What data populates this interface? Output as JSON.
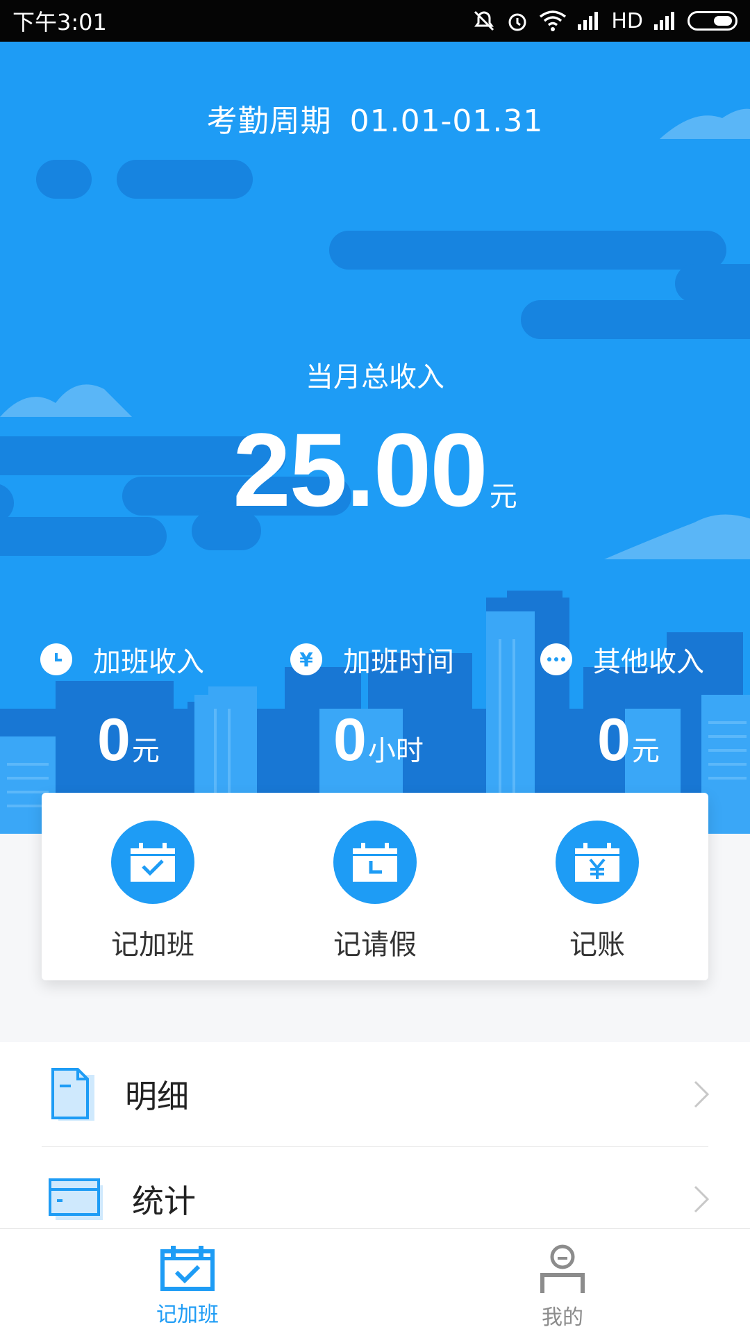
{
  "status_bar": {
    "time": "下午3:01",
    "network_label": "HD"
  },
  "header": {
    "cycle_label": "考勤周期",
    "cycle_range": "01.01-01.31"
  },
  "summary": {
    "label": "当月总收入",
    "amount": "25.00",
    "unit": "元"
  },
  "stats": [
    {
      "icon": "clock-icon",
      "label": "加班收入",
      "value": "0",
      "unit": "元"
    },
    {
      "icon": "yen-icon",
      "label": "加班时间",
      "value": "0",
      "unit": "小时"
    },
    {
      "icon": "more-icon",
      "label": "其他收入",
      "value": "0",
      "unit": "元"
    }
  ],
  "actions": [
    {
      "icon": "calendar-check-icon",
      "label": "记加班"
    },
    {
      "icon": "calendar-leave-icon",
      "label": "记请假"
    },
    {
      "icon": "calendar-yen-icon",
      "label": "记账"
    }
  ],
  "menu": [
    {
      "icon": "document-icon",
      "label": "明细"
    },
    {
      "icon": "card-icon",
      "label": "统计"
    }
  ],
  "bottom_nav": [
    {
      "icon": "calendar-check-icon",
      "label": "记加班",
      "active": true
    },
    {
      "icon": "person-icon",
      "label": "我的",
      "active": false
    }
  ],
  "colors": {
    "primary": "#1e9cf5",
    "cloud": "#1784e0",
    "building": "#1877d4"
  }
}
